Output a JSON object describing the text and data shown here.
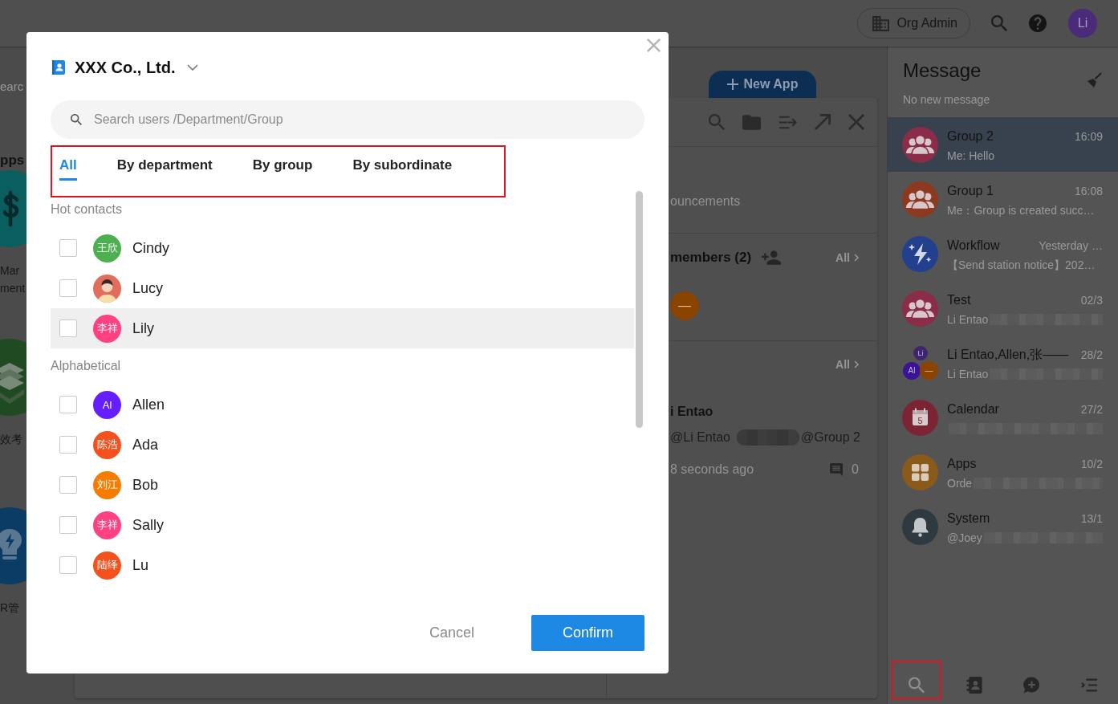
{
  "topbar": {
    "org_button": "Org Admin",
    "avatar": "Li"
  },
  "apps_panel": {
    "search_placeholder": "earc",
    "heading": "pps",
    "apps": [
      {
        "kind": "money",
        "label_lines": [
          "Mar",
          "ment"
        ]
      },
      {
        "kind": "layers",
        "label_lines": [
          "效考"
        ]
      },
      {
        "kind": "bulb",
        "label_lines": [
          "R管"
        ]
      }
    ]
  },
  "new_app_button": "New App",
  "details_panel": {
    "announcements": "ouncements",
    "members": {
      "title": "members (2)",
      "all_link": "All",
      "avatars": [
        {
          "text": "—",
          "color": "#8a4300"
        }
      ]
    },
    "mentions": {
      "all_link": "All",
      "author": "i Entao",
      "mention": "@Li Entao",
      "redacted": true,
      "group": "@Group 2",
      "time": "8 seconds ago",
      "comments": "0"
    }
  },
  "messages": {
    "title": "Message",
    "subtitle": "No new message",
    "items": [
      {
        "title": "Group 2",
        "time": "16:09",
        "preview": "Me: Hello",
        "redacted": false,
        "selected": true,
        "avatar": {
          "kind": "group",
          "color": "#8b2c49"
        }
      },
      {
        "title": "Group 1",
        "time": "16:08",
        "preview": "Me：Group is created succ…",
        "redacted": false,
        "selected": false,
        "avatar": {
          "kind": "group",
          "color": "#8c3a1f"
        }
      },
      {
        "title": "Workflow",
        "time": "Yesterday …",
        "preview": "【Send station notice】202…",
        "redacted": false,
        "selected": false,
        "avatar": {
          "kind": "workflow",
          "color": "#22408e"
        }
      },
      {
        "title": "Test",
        "time": "02/3",
        "preview": "Li Entao",
        "redacted": true,
        "selected": false,
        "avatar": {
          "kind": "group",
          "color": "#8b2c49"
        }
      },
      {
        "title": "Li Entao,Allen,张——",
        "time": "28/2",
        "preview": "Li Entao",
        "redacted": true,
        "selected": false,
        "avatar": {
          "kind": "multi",
          "members": [
            {
              "text": "Li",
              "color": "#3f2470"
            },
            {
              "text": "Al",
              "color": "#3b1496"
            },
            {
              "text": "—",
              "color": "#8a4300"
            }
          ]
        }
      },
      {
        "title": "Calendar",
        "time": "27/2",
        "redacted": true,
        "selected": false,
        "avatar": {
          "kind": "calendar",
          "text": "5",
          "color": "#7d2434"
        }
      },
      {
        "title": "Apps",
        "time": "10/2",
        "preview": "Orde",
        "redacted": true,
        "selected": false,
        "avatar": {
          "kind": "apps",
          "color": "#8a5a1a"
        }
      },
      {
        "title": "System",
        "time": "13/1",
        "preview": "@Joey",
        "redacted": true,
        "selected": false,
        "avatar": {
          "kind": "bell",
          "color": "#2e3a40"
        }
      }
    ],
    "nav": [
      {
        "kind": "search",
        "highlighted": true
      },
      {
        "kind": "contacts",
        "highlighted": false
      },
      {
        "kind": "new-chat",
        "highlighted": false
      },
      {
        "kind": "menu",
        "highlighted": false
      }
    ]
  },
  "dialog": {
    "org": "XXX Co., Ltd.",
    "search": {
      "placeholder": "Search users /Department/Group"
    },
    "tabs_highlighted": true,
    "tabs": [
      {
        "label": "All",
        "selected": true
      },
      {
        "label": "By department",
        "selected": false
      },
      {
        "label": "By group",
        "selected": false
      },
      {
        "label": "By subordinate",
        "selected": false
      }
    ],
    "sections": [
      {
        "title": "Hot contacts",
        "contacts": [
          {
            "name": "Cindy",
            "checked": false,
            "hovered": false,
            "avatar": {
              "kind": "initials",
              "text": "王欣",
              "color": "#4caf50"
            }
          },
          {
            "name": "Lucy",
            "checked": false,
            "hovered": false,
            "avatar": {
              "kind": "picture",
              "color": "#e26d5c"
            }
          },
          {
            "name": "Lily",
            "checked": false,
            "hovered": true,
            "avatar": {
              "kind": "initials",
              "text": "李祥",
              "color": "#ff4081"
            }
          }
        ]
      },
      {
        "title": "Alphabetical",
        "contacts": [
          {
            "name": "Allen",
            "checked": false,
            "hovered": false,
            "avatar": {
              "kind": "initials",
              "text": "Al",
              "color": "#651fff"
            }
          },
          {
            "name": "Ada",
            "checked": false,
            "hovered": false,
            "avatar": {
              "kind": "initials",
              "text": "陈浩",
              "color": "#f4511e"
            }
          },
          {
            "name": "Bob",
            "checked": false,
            "hovered": false,
            "avatar": {
              "kind": "initials",
              "text": "刘江",
              "color": "#f57c00"
            }
          },
          {
            "name": "Sally",
            "checked": false,
            "hovered": false,
            "avatar": {
              "kind": "initials",
              "text": "李祥",
              "color": "#ff4081"
            }
          },
          {
            "name": "Lu",
            "checked": false,
            "hovered": false,
            "avatar": {
              "kind": "initials",
              "text": "陆绎",
              "color": "#f4511e"
            }
          }
        ]
      }
    ],
    "buttons": {
      "cancel": "Cancel",
      "confirm": "Confirm"
    }
  }
}
